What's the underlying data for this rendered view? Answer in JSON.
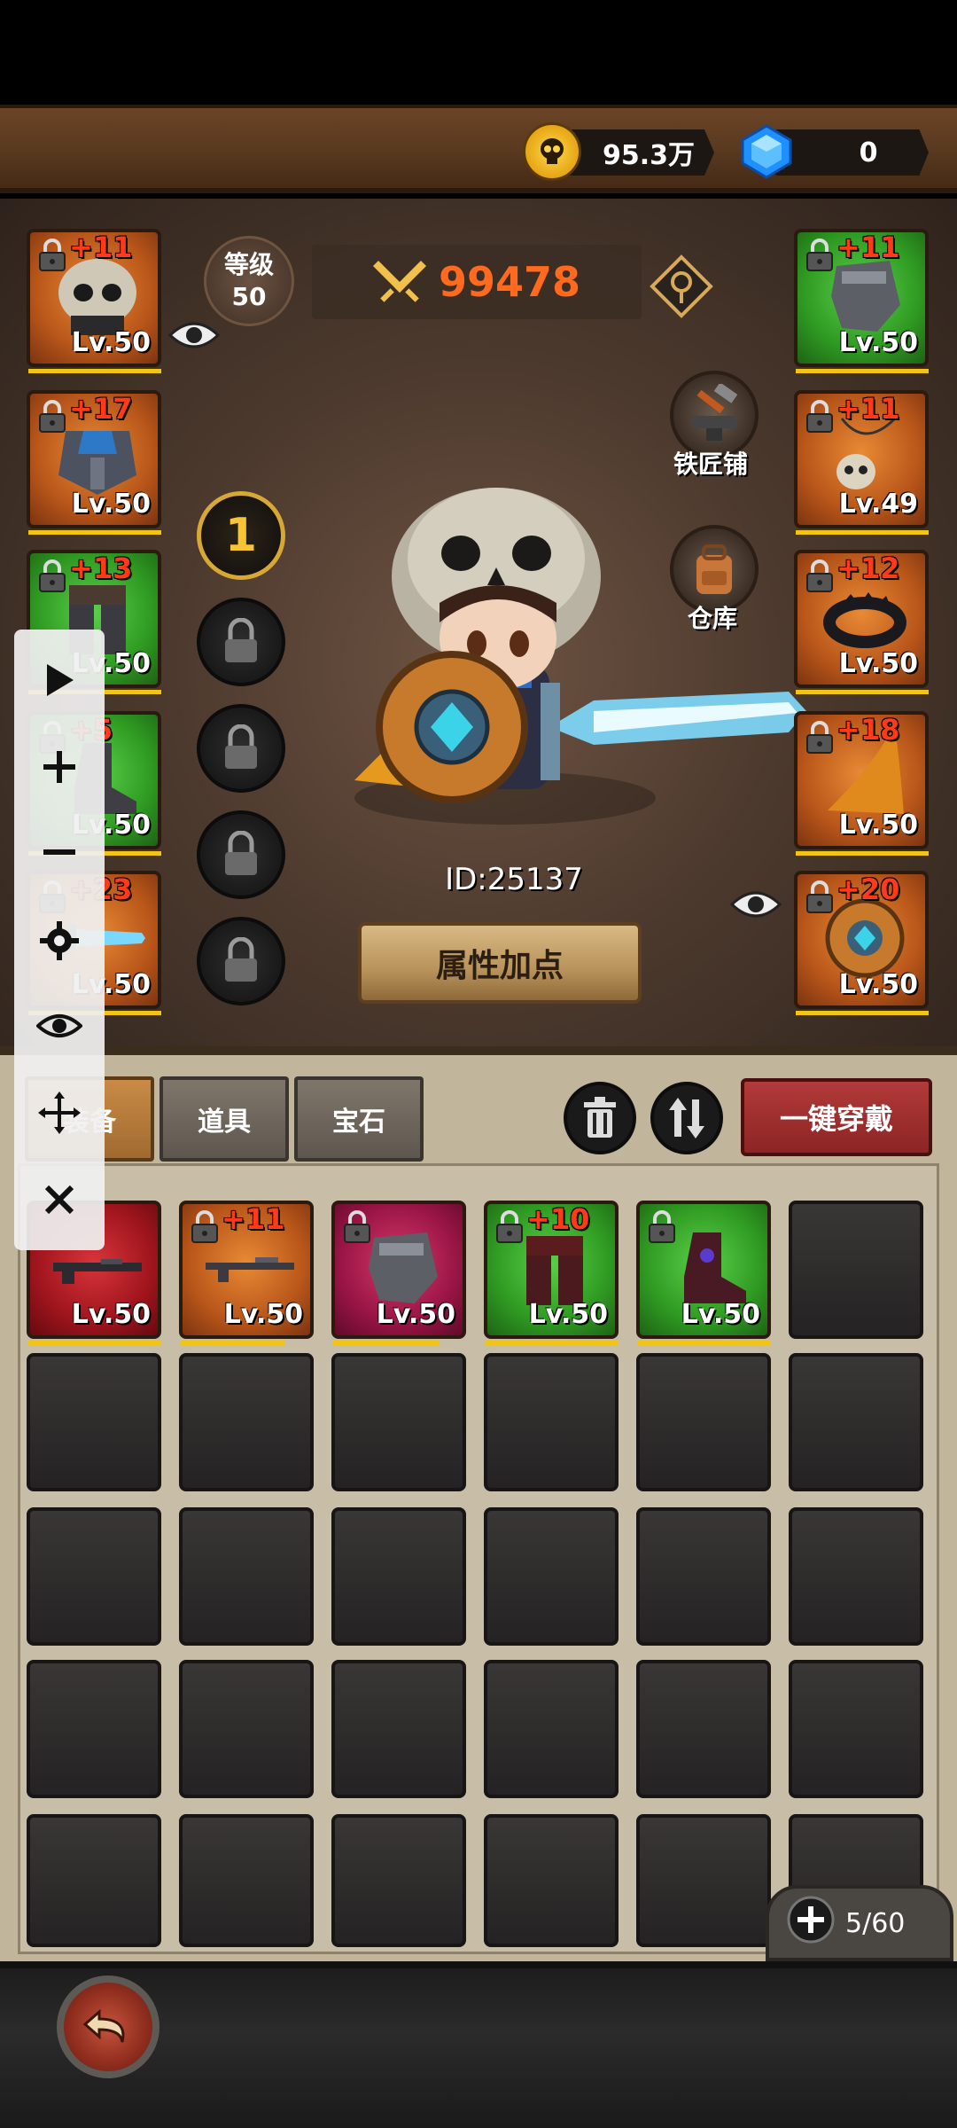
{
  "currency": {
    "gold": "95.3万",
    "diamond": "0"
  },
  "hero": {
    "level_label": "等级",
    "level_value": "50",
    "power": "99478",
    "player_id": "ID:25137",
    "attr_button": "属性加点",
    "blacksmith": "铁匠铺",
    "warehouse": "仓库",
    "skill_slot_1": "1"
  },
  "left_slots": [
    {
      "plus": "+11",
      "lv": "Lv.50",
      "color": "orange",
      "icon": "skull-helmet-icon"
    },
    {
      "plus": "+17",
      "lv": "Lv.50",
      "color": "orange",
      "icon": "chest-armor-icon"
    },
    {
      "plus": "+13",
      "lv": "Lv.50",
      "color": "green",
      "icon": "leg-armor-icon"
    },
    {
      "plus": "+5",
      "lv": "Lv.50",
      "color": "green",
      "icon": "boots-icon"
    },
    {
      "plus": "+23",
      "lv": "Lv.50",
      "color": "orange",
      "icon": "ice-sword-icon"
    }
  ],
  "right_slots": [
    {
      "plus": "+11",
      "lv": "Lv.50",
      "color": "green",
      "icon": "gauntlet-icon"
    },
    {
      "plus": "+11",
      "lv": "Lv.49",
      "color": "orange",
      "icon": "skull-necklace-icon"
    },
    {
      "plus": "+12",
      "lv": "Lv.50",
      "color": "orange",
      "icon": "dark-ring-icon"
    },
    {
      "plus": "+18",
      "lv": "Lv.50",
      "color": "orange",
      "icon": "cape-icon"
    },
    {
      "plus": "+20",
      "lv": "Lv.50",
      "color": "orange",
      "icon": "round-shield-icon"
    }
  ],
  "tabs": [
    {
      "label": "装备",
      "active": true
    },
    {
      "label": "道具",
      "active": false
    },
    {
      "label": "宝石",
      "active": false
    }
  ],
  "equip_all_label": "一键穿戴",
  "inventory": {
    "items": [
      {
        "plus": "",
        "lv": "Lv.50",
        "color": "red",
        "icon": "dark-rifle-icon"
      },
      {
        "plus": "+11",
        "lv": "Lv.50",
        "color": "orange",
        "icon": "rifle-icon"
      },
      {
        "plus": "",
        "lv": "Lv.50",
        "color": "crimson",
        "icon": "gauntlet-icon"
      },
      {
        "plus": "+10",
        "lv": "Lv.50",
        "color": "green",
        "icon": "leg-armor-icon"
      },
      {
        "plus": "",
        "lv": "Lv.50",
        "color": "green",
        "icon": "red-boots-icon"
      }
    ],
    "capacity": "5/60"
  }
}
